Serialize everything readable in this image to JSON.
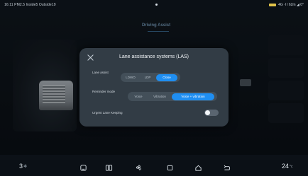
{
  "status_bar": {
    "left_text": "16:11  PM2.5 Inside5  Outside19",
    "right_text": "4G  ·l l  62m  ◢  0°"
  },
  "background": {
    "tabs": [
      "Driving Assist",
      "",
      ""
    ]
  },
  "modal": {
    "title": "Lane assistance systems (LAS)",
    "lane_assist": {
      "label": "Lane assist",
      "options": [
        "LDWO",
        "LDP",
        "Close"
      ],
      "selected": "Close"
    },
    "reminder_mode": {
      "label": "Reminder mode",
      "options": [
        "Voice",
        "Vibration",
        "Voice + vibration"
      ],
      "selected": "Voice + vibration"
    },
    "urgent_lane_keeping": {
      "label": "Urgent Lane Keeping",
      "on": false
    }
  },
  "dock": {
    "temp_left": "3",
    "temp_left_icon": "fan-icon",
    "temp_right": "24",
    "temp_right_unit": "°c",
    "icons": [
      "seat-icon",
      "grid-icon",
      "fan-icon",
      "square-icon",
      "home-icon",
      "back-icon"
    ]
  },
  "colors": {
    "accent": "#1f8ef1",
    "modal_bg": "#343e48",
    "screen_bg": "#0c1116"
  }
}
